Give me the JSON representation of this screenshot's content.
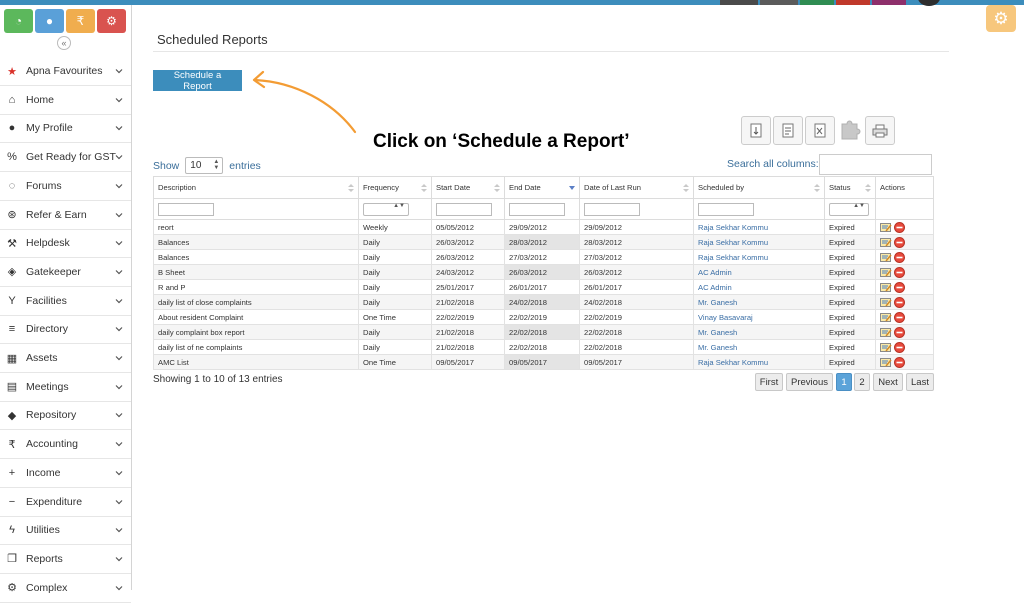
{
  "colors": {
    "accent": "#3c8dbc",
    "callout_arrow": "#f39c34",
    "status_bar": [
      "#3c8dbc",
      "#4a4a4a",
      "#5b5b5b",
      "#2f8d53",
      "#c0392b",
      "#8e2f6b"
    ]
  },
  "quick_icons": [
    {
      "name": "dashboard-icon",
      "color": "#5cb85c",
      "glyph": "◔"
    },
    {
      "name": "chat-icon",
      "color": "#5aa0d8",
      "glyph": "●"
    },
    {
      "name": "rupee-icon",
      "color": "#f0ad4e",
      "glyph": "₹"
    },
    {
      "name": "settings-icon",
      "color": "#d9534f",
      "glyph": "⚙"
    }
  ],
  "sidebar": {
    "collapse_glyph": "«",
    "items": [
      {
        "label": "Apna Favourites",
        "icon": "star-icon",
        "glyph": "★"
      },
      {
        "label": "Home",
        "icon": "home-icon",
        "glyph": "⌂"
      },
      {
        "label": "My Profile",
        "icon": "user-icon",
        "glyph": "●"
      },
      {
        "label": "Get Ready for GST",
        "icon": "percent-icon",
        "glyph": "%"
      },
      {
        "label": "Forums",
        "icon": "comments-icon",
        "glyph": "◌"
      },
      {
        "label": "Refer & Earn",
        "icon": "handshake-icon",
        "glyph": "⊛"
      },
      {
        "label": "Helpdesk",
        "icon": "wrench-icon",
        "glyph": "⚒"
      },
      {
        "label": "Gatekeeper",
        "icon": "shield-icon",
        "glyph": "◈"
      },
      {
        "label": "Facilities",
        "icon": "filter-icon",
        "glyph": "Y"
      },
      {
        "label": "Directory",
        "icon": "list-icon",
        "glyph": "≡"
      },
      {
        "label": "Assets",
        "icon": "building-icon",
        "glyph": "▦"
      },
      {
        "label": "Meetings",
        "icon": "calendar-icon",
        "glyph": "▤"
      },
      {
        "label": "Repository",
        "icon": "dropbox-icon",
        "glyph": "◆"
      },
      {
        "label": "Accounting",
        "icon": "rupee-icon",
        "glyph": "₹"
      },
      {
        "label": "Income",
        "icon": "plus-icon",
        "glyph": "+"
      },
      {
        "label": "Expenditure",
        "icon": "minus-icon",
        "glyph": "−"
      },
      {
        "label": "Utilities",
        "icon": "bolt-icon",
        "glyph": "ϟ"
      },
      {
        "label": "Reports",
        "icon": "copy-icon",
        "glyph": "❐"
      },
      {
        "label": "Complex",
        "icon": "cog-icon",
        "glyph": "⚙"
      }
    ]
  },
  "page": {
    "title": "Scheduled Reports",
    "schedule_button": "Schedule a Report",
    "callout": "Click on ‘Schedule a Report’"
  },
  "toolbar_icons": [
    "copy-icon",
    "csv-icon",
    "excel-icon",
    "pdf-icon",
    "print-icon"
  ],
  "table_controls": {
    "show_label": "Show",
    "length_value": "10",
    "entries_label": "entries",
    "search_label": "Search all columns:",
    "search_value": ""
  },
  "table": {
    "columns": [
      "Description",
      "Frequency",
      "Start Date",
      "End Date",
      "Date of Last Run",
      "Scheduled by",
      "Status",
      "Actions"
    ],
    "rows": [
      [
        "reort",
        "Weekly",
        "05/05/2012",
        "29/09/2012",
        "29/09/2012",
        "Raja Sekhar Kommu",
        "Expired"
      ],
      [
        "Balances",
        "Daily",
        "26/03/2012",
        "28/03/2012",
        "28/03/2012",
        "Raja Sekhar Kommu",
        "Expired"
      ],
      [
        "Balances",
        "Daily",
        "26/03/2012",
        "27/03/2012",
        "27/03/2012",
        "Raja Sekhar Kommu",
        "Expired"
      ],
      [
        "B Sheet",
        "Daily",
        "24/03/2012",
        "26/03/2012",
        "26/03/2012",
        "AC Admin",
        "Expired"
      ],
      [
        "R and P",
        "Daily",
        "25/01/2017",
        "26/01/2017",
        "26/01/2017",
        "AC Admin",
        "Expired"
      ],
      [
        "daily list of close complaints",
        "Daily",
        "21/02/2018",
        "24/02/2018",
        "24/02/2018",
        "Mr. Ganesh",
        "Expired"
      ],
      [
        "About resident Complaint",
        "One Time",
        "22/02/2019",
        "22/02/2019",
        "22/02/2019",
        "Vinay Basavaraj",
        "Expired"
      ],
      [
        "daily complaint box report",
        "Daily",
        "21/02/2018",
        "22/02/2018",
        "22/02/2018",
        "Mr. Ganesh",
        "Expired"
      ],
      [
        "daily list of ne complaints",
        "Daily",
        "21/02/2018",
        "22/02/2018",
        "22/02/2018",
        "Mr. Ganesh",
        "Expired"
      ],
      [
        "AMC List",
        "One Time",
        "09/05/2017",
        "09/05/2017",
        "09/05/2017",
        "Raja Sekhar Kommu",
        "Expired"
      ]
    ]
  },
  "pagination": {
    "info": "Showing 1 to 10 of 13 entries",
    "first": "First",
    "previous": "Previous",
    "pages": [
      "1",
      "2"
    ],
    "current_page": "1",
    "next": "Next",
    "last": "Last"
  }
}
